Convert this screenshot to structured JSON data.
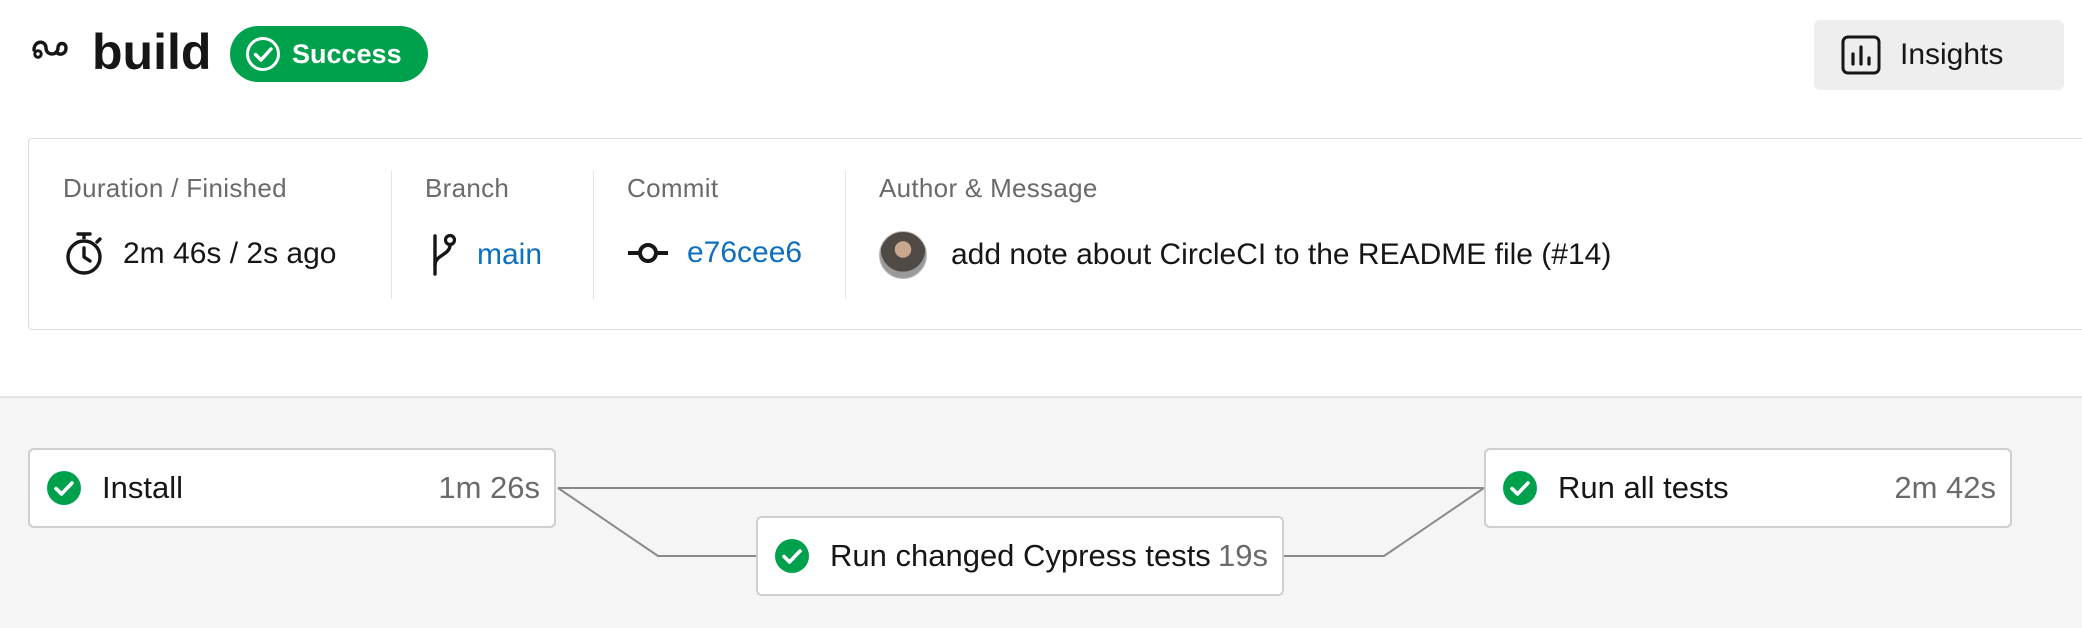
{
  "header": {
    "workflow_icon": "workflow-icon",
    "title": "build",
    "status": "Success",
    "status_color": "#00a14c",
    "insights_label": "Insights",
    "insights_icon": "bar-chart-icon"
  },
  "details": {
    "duration": {
      "label": "Duration / Finished",
      "value": "2m 46s / 2s ago",
      "icon": "stopwatch-icon"
    },
    "branch": {
      "label": "Branch",
      "value": "main",
      "icon": "git-branch-icon"
    },
    "commit": {
      "label": "Commit",
      "value": "e76cee6",
      "icon": "git-commit-icon"
    },
    "author": {
      "label": "Author & Message",
      "message": "add note about CircleCI to the README file (#14)",
      "icon": "avatar"
    }
  },
  "pipeline": {
    "jobs": [
      {
        "name": "Install",
        "duration": "1m 26s",
        "status": "success"
      },
      {
        "name": "Run changed Cypress tests",
        "duration": "19s",
        "status": "success"
      },
      {
        "name": "Run all tests",
        "duration": "2m 42s",
        "status": "success"
      }
    ]
  },
  "colors": {
    "link": "#0e6fbe",
    "success": "#00a14c",
    "pipeline_bg": "#f5f5f5"
  }
}
